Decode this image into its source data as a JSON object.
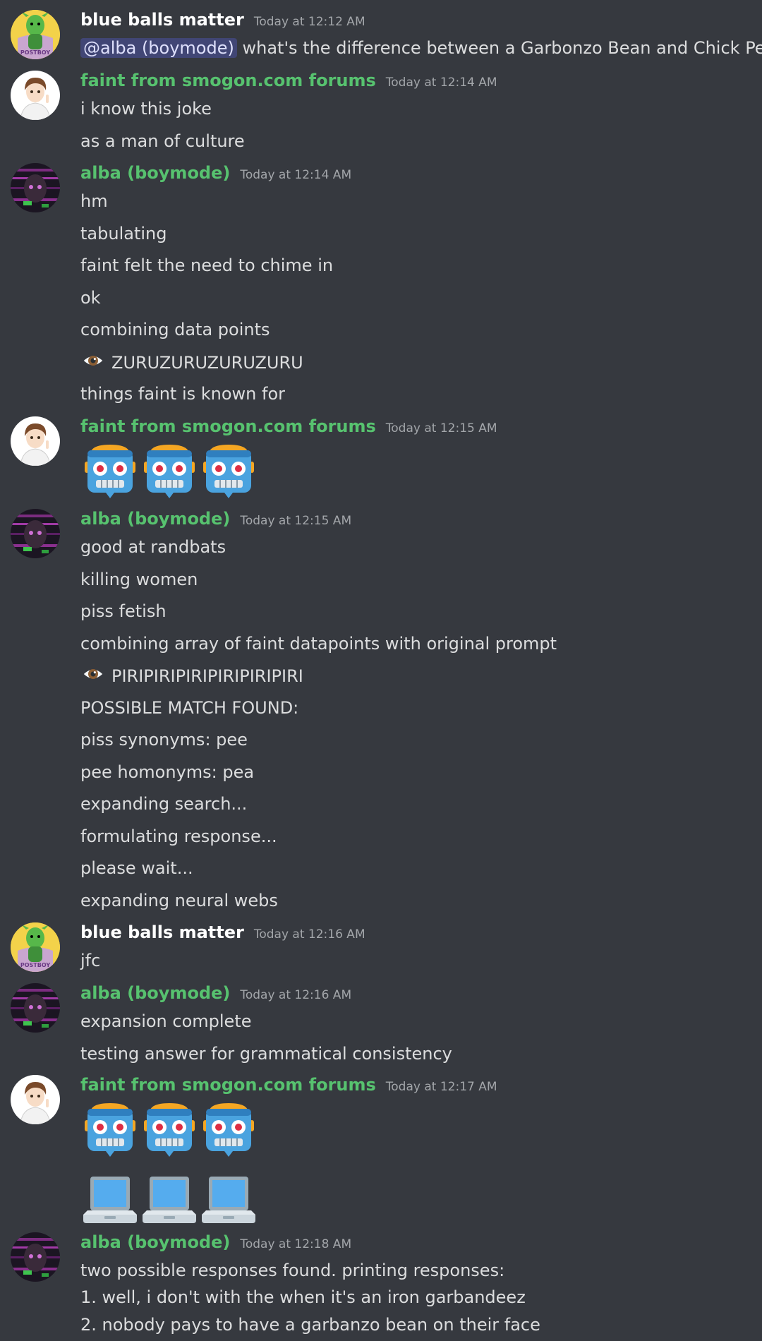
{
  "colors": {
    "background": "#36393f",
    "text": "#dcddde",
    "timestamp": "#a3a6aa",
    "username_white": "#ffffff",
    "username_green": "#57c26f",
    "mention_bg": "#414675"
  },
  "messages": [
    {
      "author": "blue balls matter",
      "time": "Today at 12:12 AM",
      "mention": "@alba (boymode)",
      "lines": [
        "what's the difference between a Garbonzo Bean and Chick Pea"
      ]
    },
    {
      "author": "faint from smogon.com forums",
      "time": "Today at 12:14 AM",
      "lines": [
        "i know this joke",
        "as a man of culture"
      ]
    },
    {
      "author": "alba (boymode)",
      "time": "Today at 12:14 AM",
      "lines": [
        "hm",
        "tabulating",
        "faint felt the need to chime in",
        "ok",
        "combining data points",
        "ZURUZURUZURUZURU",
        "things faint is known for"
      ]
    },
    {
      "author": "faint from smogon.com forums",
      "time": "Today at 12:15 AM",
      "emojis": [
        "robot-emoji",
        "robot-emoji",
        "robot-emoji"
      ]
    },
    {
      "author": "alba (boymode)",
      "time": "Today at 12:15 AM",
      "lines": [
        "good at randbats",
        "killing women",
        "piss fetish",
        "combining array of faint datapoints with original prompt",
        "PIRIPIRIPIRIPIRIPIRIPIRI",
        "POSSIBLE MATCH FOUND:",
        "piss synonyms: pee",
        "pee homonyms: pea",
        "expanding search...",
        "formulating response...",
        "please wait...",
        "expanding neural webs"
      ]
    },
    {
      "author": "blue balls matter",
      "time": "Today at 12:16 AM",
      "lines": [
        "jfc"
      ]
    },
    {
      "author": "alba (boymode)",
      "time": "Today at 12:16 AM",
      "lines": [
        "expansion complete",
        "testing answer for grammatical consistency"
      ]
    },
    {
      "author": "faint from smogon.com forums",
      "time": "Today at 12:17 AM",
      "emojis": [
        "robot-emoji",
        "robot-emoji",
        "robot-emoji"
      ],
      "emojis2": [
        "laptop-emoji",
        "laptop-emoji",
        "laptop-emoji"
      ]
    },
    {
      "author": "alba (boymode)",
      "time": "Today at 12:18 AM",
      "lines": [
        "two possible responses found. printing responses:",
        "1. well, i don't with the when it's an iron garbandeez",
        "2. nobody pays to have a garbanzo bean on their face"
      ]
    }
  ],
  "icons": {
    "eye": "eye-emoji",
    "avatars": [
      "green-character-avatar",
      "anime-boy-avatar",
      "dark-glitch-avatar"
    ]
  }
}
